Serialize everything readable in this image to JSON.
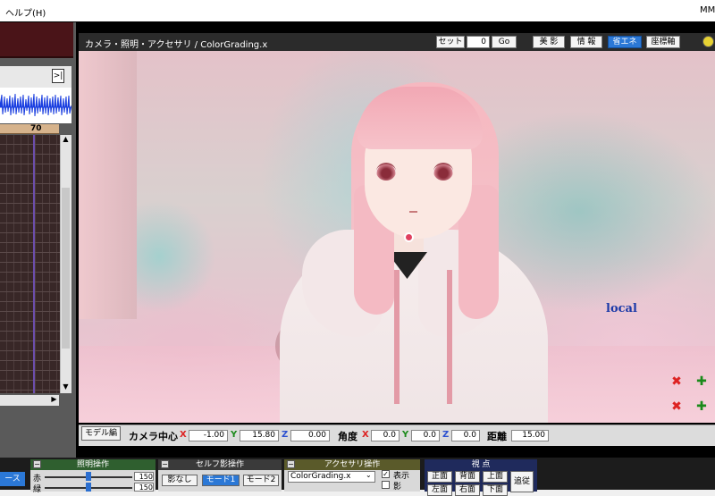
{
  "menu": {
    "help": "ヘルプ(H)",
    "right_fragment": "MM"
  },
  "timeline": {
    "expand_glyph": ">|",
    "current_frame": "70"
  },
  "viewport": {
    "title": "カメラ・照明・アクセサリ / ColorGrading.x",
    "set_label": "セット",
    "frame_value": "0",
    "go_label": "Go",
    "beauty_shadow_label": "美 影",
    "info_label": "情 報",
    "eco_label": "省エネ",
    "coord_label": "座標軸",
    "axis_space_label": "local"
  },
  "camera_bar": {
    "model_edit_label": "モデル編",
    "camera_center_label": "カメラ中心",
    "center": {
      "x_label": "X",
      "x": "-1.00",
      "y_label": "Y",
      "y": "15.80",
      "z_label": "Z",
      "z": "0.00"
    },
    "angle_label": "角度",
    "angle": {
      "x_label": "X",
      "x": "0.0",
      "y_label": "Y",
      "y": "0.0",
      "z_label": "Z",
      "z": "0.0"
    },
    "distance_label": "距離",
    "distance": "15.00"
  },
  "bottom": {
    "face_btn_fragment": "ース",
    "lighting": {
      "title": "照明操作",
      "rows": [
        {
          "label": "赤",
          "value": "150",
          "level": 0.5
        },
        {
          "label": "緑",
          "value": "150",
          "level": 0.5
        }
      ]
    },
    "self_shadow": {
      "title": "セルフ影操作",
      "none_label": "影なし",
      "mode1_label": "モード1",
      "mode2_label": "モード2"
    },
    "accessory": {
      "title": "アクセサリ操作",
      "selected": "ColorGrading.x",
      "display_label": "表示",
      "shadow_label": "影"
    },
    "view": {
      "title": "視 点",
      "front": "正面",
      "back": "背面",
      "top": "上面",
      "follow": "追従",
      "row2_a": "左面",
      "row2_b": "右面",
      "row2_c": "下面"
    }
  },
  "colors": {
    "accent_blue": "#2b78d6",
    "axis_x": "#dd2222",
    "axis_y": "#1a8a1a",
    "axis_z": "#2a4fd0",
    "panel_green": "#2f5f2f"
  }
}
